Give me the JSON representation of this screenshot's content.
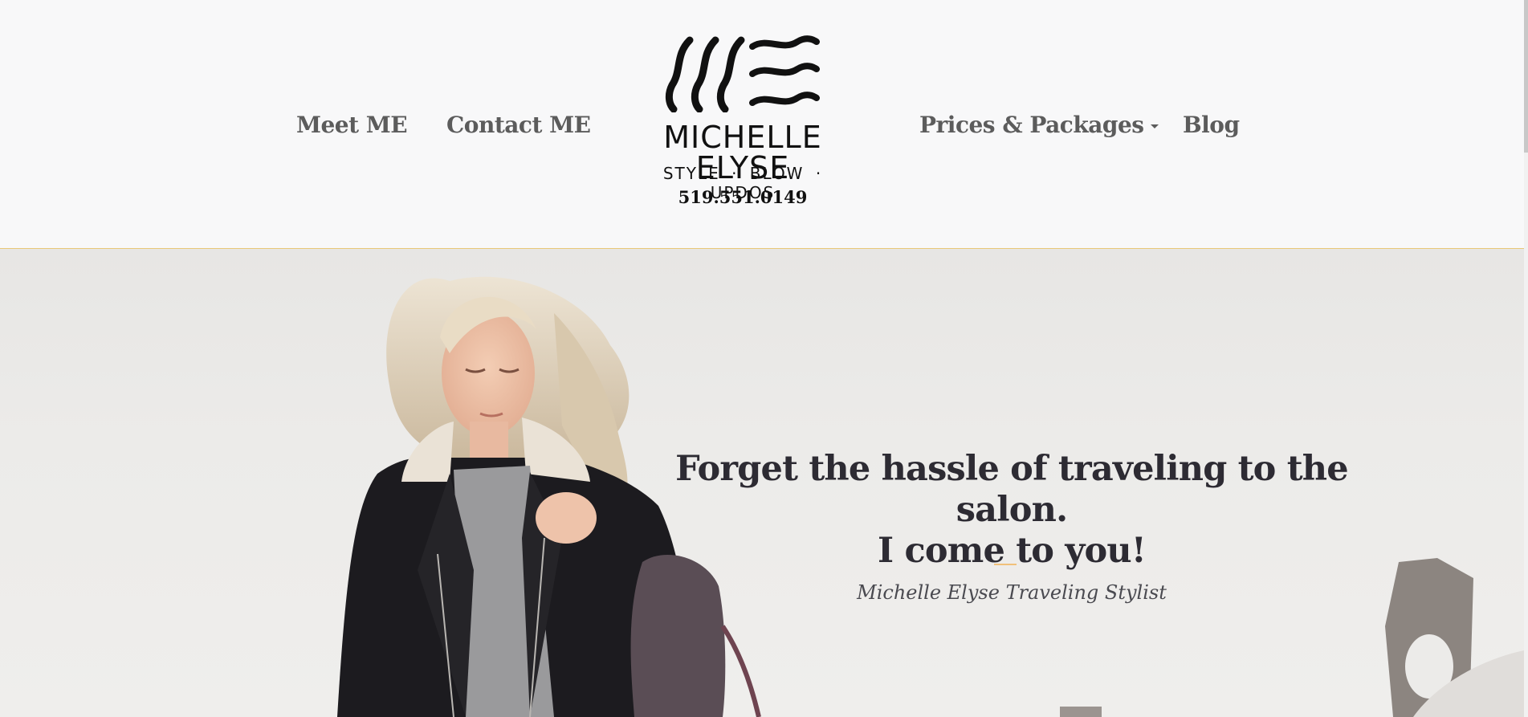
{
  "header": {
    "nav_left": [
      {
        "label": "Meet ME"
      },
      {
        "label": "Contact ME"
      }
    ],
    "nav_right": [
      {
        "label": "Prices & Packages",
        "has_dropdown": true,
        "dropdown_icon": "caret-down-icon"
      },
      {
        "label": "Blog"
      }
    ],
    "logo": {
      "icon": "wave-monogram-icon",
      "name": "MICHELLE ELYSE",
      "tagline": "STYLE  ·  BLOW  ·  UPDOS",
      "phone": "519.551.0149"
    },
    "border_color": "#e9c777"
  },
  "hero": {
    "heading_line1": "Forget the hassle of traveling to the salon.",
    "heading_line2": "I come to you!",
    "subtitle": "Michelle Elyse Traveling Stylist",
    "divider_color": "#f1c07a",
    "heading_color": "#2d2b33"
  }
}
